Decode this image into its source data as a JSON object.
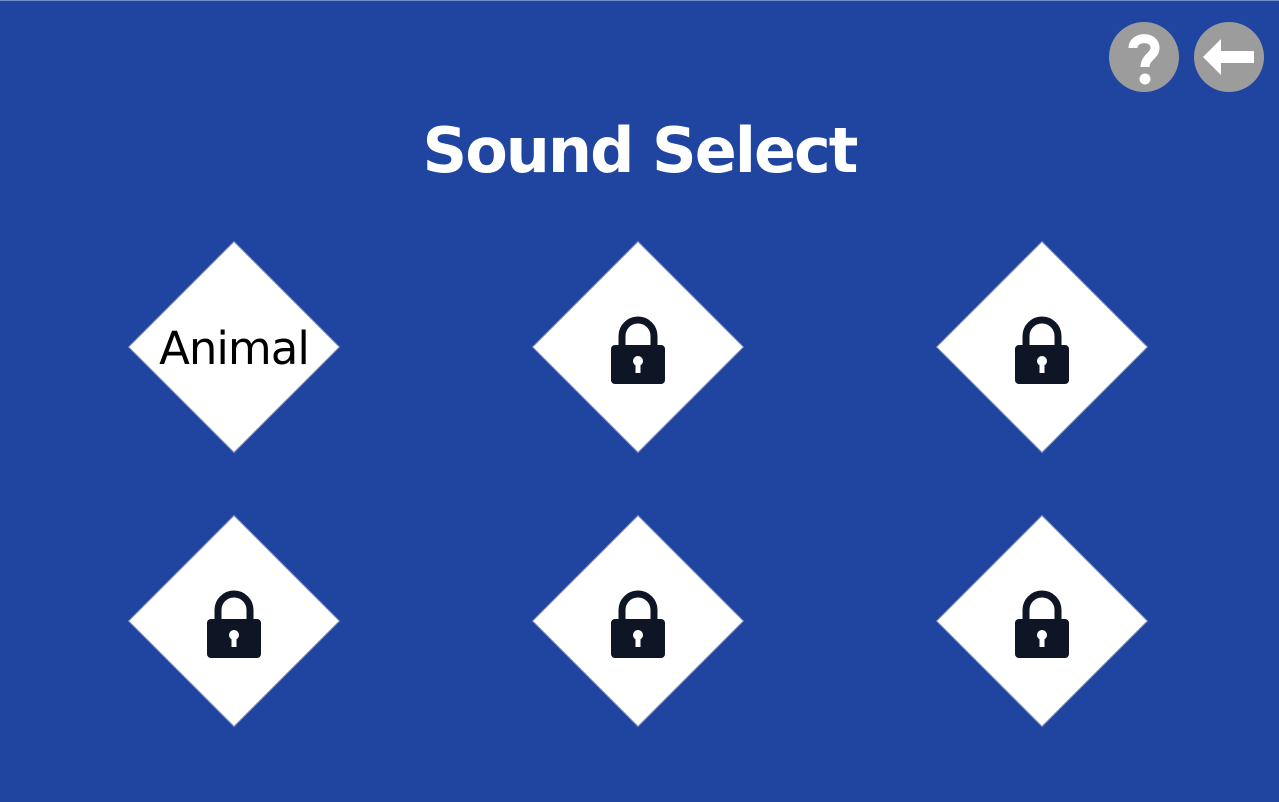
{
  "title": "Sound Select",
  "header_buttons": {
    "help_icon": "question-mark-icon",
    "back_icon": "left-arrow-icon"
  },
  "categories": [
    {
      "label": "Animal",
      "locked": false
    },
    {
      "label": "",
      "locked": true,
      "icon": "lock-icon"
    },
    {
      "label": "",
      "locked": true,
      "icon": "lock-icon"
    },
    {
      "label": "",
      "locked": true,
      "icon": "lock-icon"
    },
    {
      "label": "",
      "locked": true,
      "icon": "lock-icon"
    },
    {
      "label": "",
      "locked": true,
      "icon": "lock-icon"
    }
  ],
  "colors": {
    "background": "#1f45a0",
    "tile": "#ffffff",
    "lock": "#0e1626",
    "button": "#9c9c9c"
  }
}
